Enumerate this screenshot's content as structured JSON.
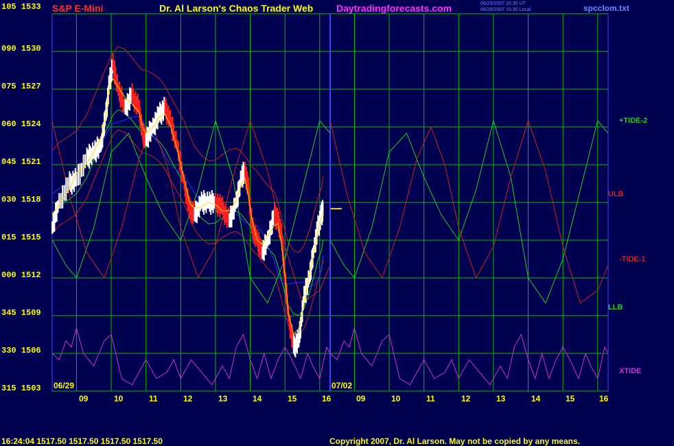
{
  "header": {
    "symbol": "S&P E-Mini",
    "title": "Dr. Al Larson's Chaos Trader Web",
    "site": "Daytradingforecasts.com",
    "stamp1": "06/29/2007 20:30 UT",
    "stamp2": "06/29/2007 15:30 Local",
    "file": "spcclom.txt"
  },
  "footer": {
    "quote": "16:24:04  1517.50  1517.50  1517.50  1517.50",
    "copyright": "Copyright 2007, Dr. Al Larson. May not be copied by any means."
  },
  "colors": {
    "background": "#000050",
    "grid": "#00c000",
    "price_white": "#ffffff",
    "price_red": "#ff2020",
    "tide2": "#20d020",
    "tide1": "#d02020",
    "xtide": "#d030d0",
    "avg": "#ffd800",
    "blue_avg": "#3030ff",
    "divider": "#4040ff"
  },
  "chart_data": {
    "type": "line",
    "title": "S&P E-Mini",
    "y_ticks": [
      "105 1533",
      "090 1530",
      "075 1527",
      "060 1524",
      "045 1521",
      "030 1518",
      "015 1515",
      "000 1512",
      "345 1509",
      "330 1506",
      "315 1503"
    ],
    "ylim": [
      1503,
      1533
    ],
    "xlim": [
      8.3,
      16.3
    ],
    "session_labels": [
      "06/29",
      "07/02"
    ],
    "x_ticks_day1": [
      "09",
      "10",
      "11",
      "12",
      "13",
      "14",
      "15",
      "16"
    ],
    "x_ticks_day2": [
      "09",
      "10",
      "11",
      "12",
      "13",
      "14",
      "15",
      "16"
    ],
    "series_labels": [
      "+TIDE-2",
      "ULB",
      "-TIDE-1",
      "LLB",
      "XTIDE"
    ],
    "last_price": 1517.5,
    "price": {
      "x": [
        8.3,
        8.5,
        8.8,
        9.0,
        9.3,
        9.5,
        9.7,
        9.85,
        9.95,
        10.05,
        10.2,
        10.4,
        10.6,
        10.8,
        10.9,
        11.0,
        11.2,
        11.4,
        11.55,
        11.7,
        11.9,
        12.1,
        12.25,
        12.4,
        12.6,
        12.8,
        13.0,
        13.2,
        13.4,
        13.6,
        13.75,
        13.85,
        13.95,
        14.05,
        14.2,
        14.35,
        14.5,
        14.7,
        14.8,
        14.9,
        15.0,
        15.1,
        15.25,
        15.4,
        15.55,
        15.7,
        15.85,
        15.95,
        16.05,
        16.1
      ],
      "values": [
        1516,
        1518,
        1519.5,
        1519.8,
        1521.5,
        1522,
        1522.5,
        1525,
        1527.5,
        1529,
        1527,
        1525.5,
        1526.5,
        1525.5,
        1523.5,
        1523,
        1524,
        1525,
        1525.5,
        1524.5,
        1522.5,
        1519.5,
        1517.5,
        1517,
        1518,
        1518,
        1518,
        1517.5,
        1516.5,
        1518,
        1520,
        1520.5,
        1519,
        1516,
        1515,
        1514,
        1515,
        1517,
        1516.5,
        1515.5,
        1512,
        1509,
        1506.5,
        1507,
        1510.5,
        1512,
        1514.5,
        1516,
        1517,
        1517.5
      ]
    },
    "series": [
      {
        "name": "+TIDE-2",
        "color": "#20d020",
        "x": [
          8.3,
          8.7,
          9.0,
          9.5,
          10.0,
          10.5,
          11.0,
          11.5,
          12.0,
          12.5,
          13.0,
          13.5,
          14.0,
          14.5,
          15.0,
          15.5,
          16.0,
          16.3
        ],
        "values": [
          1515,
          1513,
          1512,
          1516,
          1522,
          1523.5,
          1520,
          1517,
          1515,
          1519,
          1524.5,
          1520,
          1512,
          1510,
          1513.5,
          1519,
          1524.5,
          1523.5
        ]
      },
      {
        "name": "-TIDE-1",
        "color": "#d02020",
        "x": [
          8.3,
          8.8,
          9.3,
          9.8,
          10.3,
          10.8,
          11.2,
          11.6,
          12.0,
          12.5,
          13.0,
          13.5,
          14.0,
          14.5,
          15.0,
          15.5,
          16.0,
          16.3
        ],
        "values": [
          1524.5,
          1518.5,
          1514,
          1512,
          1516,
          1521.5,
          1524,
          1521,
          1516,
          1512,
          1514.5,
          1520,
          1524.5,
          1520.5,
          1514.5,
          1510,
          1511,
          1513
        ]
      },
      {
        "name": "XTIDE",
        "color": "#d030d0",
        "x": [
          8.3,
          8.5,
          8.7,
          8.85,
          9.0,
          9.2,
          9.5,
          9.8,
          10.0,
          10.3,
          10.6,
          11.0,
          11.3,
          11.6,
          11.8,
          12.0,
          12.3,
          12.6,
          12.9,
          13.2,
          13.4,
          13.6,
          13.8,
          14.0,
          14.2,
          14.4,
          14.6,
          14.8,
          15.0,
          15.2,
          15.45,
          15.65,
          15.8,
          16.0,
          16.2,
          16.3
        ],
        "values": [
          1506,
          1505.5,
          1507,
          1506.5,
          1508,
          1506,
          1505,
          1507,
          1507.5,
          1504,
          1503.5,
          1505.5,
          1504,
          1504.5,
          1505.5,
          1504,
          1505.5,
          1504.5,
          1503.5,
          1505,
          1504,
          1506.5,
          1507.5,
          1505.5,
          1504,
          1506,
          1504,
          1505.5,
          1506.5,
          1505.5,
          1504,
          1506,
          1505,
          1504,
          1506.5,
          1506
        ]
      }
    ]
  }
}
